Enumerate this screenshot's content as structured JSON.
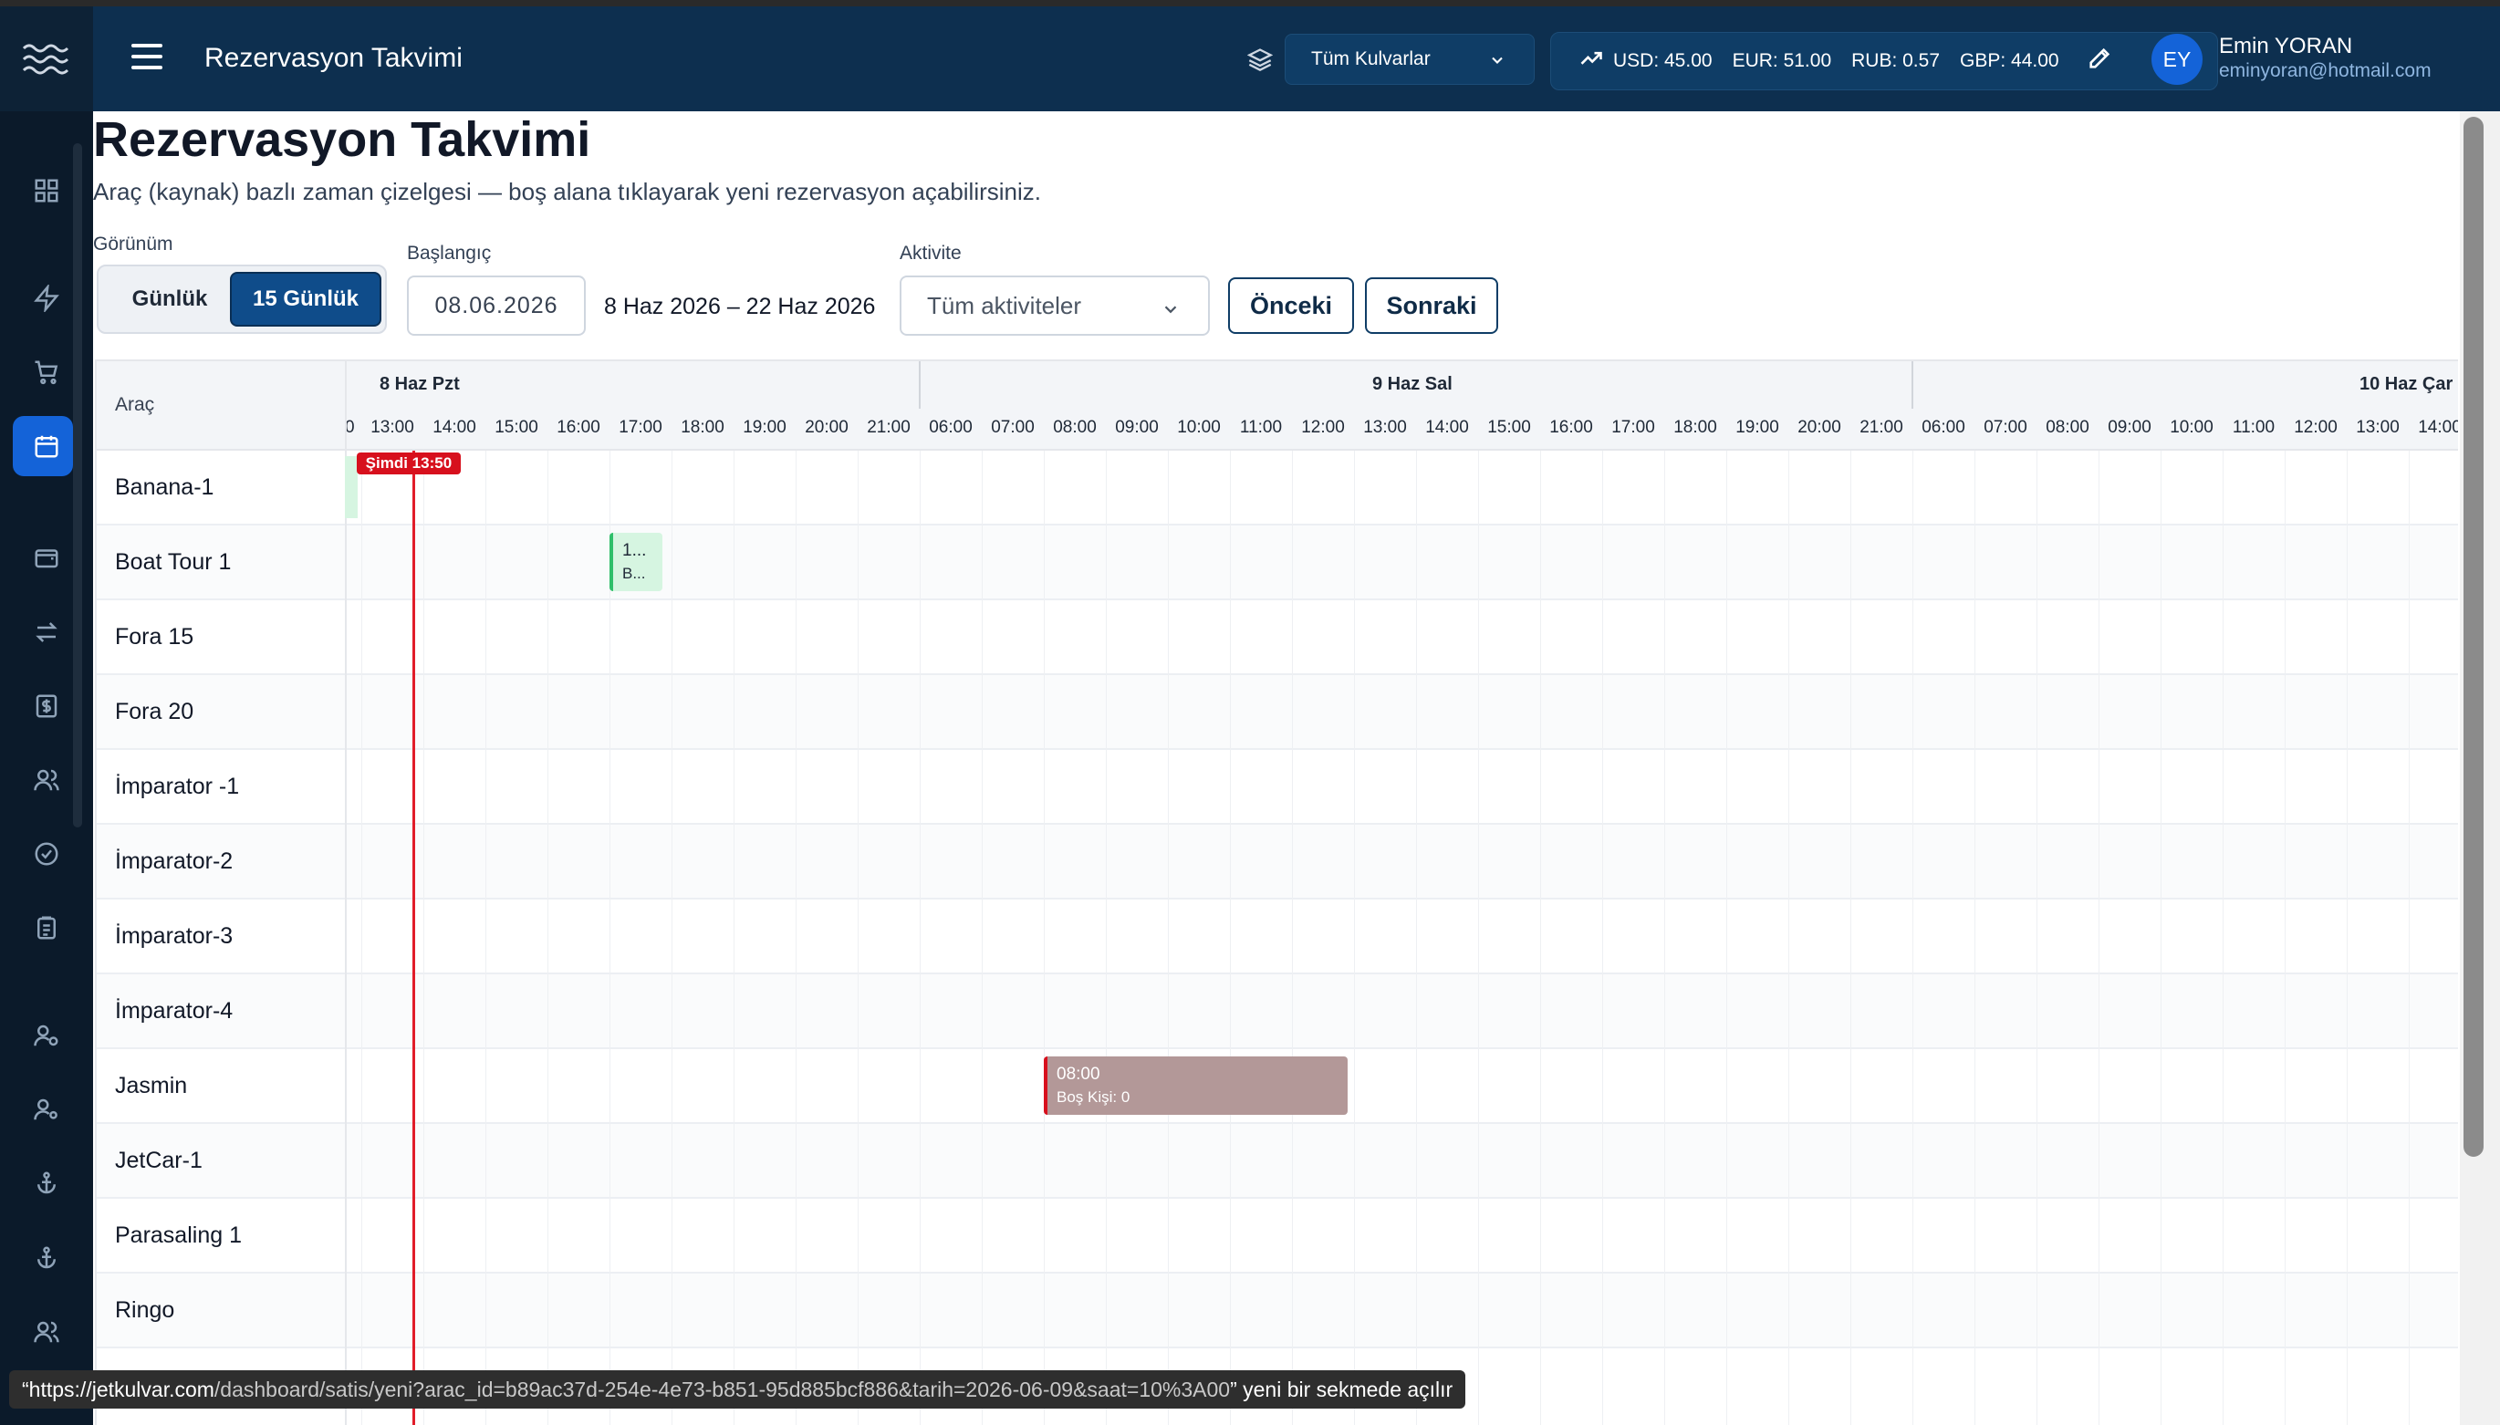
{
  "header": {
    "title": "Rezervasyon Takvimi",
    "route_select": "Tüm Kulvarlar",
    "rates": [
      "USD: 45.00",
      "EUR: 51.00",
      "RUB: 0.57",
      "GBP: 44.00"
    ],
    "user": {
      "initials": "EY",
      "name": "Emin YORAN",
      "email": "eminyoran@hotmail.com"
    }
  },
  "page": {
    "title": "Rezervasyon Takvimi",
    "subtitle": "Araç (kaynak) bazlı zaman çizelgesi — boş alana tıklayarak yeni rezervasyon açabilirsiniz."
  },
  "controls": {
    "view_label": "Görünüm",
    "view_daily": "Günlük",
    "view_15": "15 Günlük",
    "start_label": "Başlangıç",
    "start_value": "08.06.2026",
    "range": "8 Haz 2026 – 22 Haz 2026",
    "activity_label": "Aktivite",
    "activity_value": "Tüm aktiviteler",
    "prev": "Önceki",
    "next": "Sonraki"
  },
  "timeline": {
    "resource_header": "Araç",
    "days": [
      {
        "label": "8 Haz Pzt",
        "hours": [
          "13:00",
          "14:00",
          "15:00",
          "16:00",
          "17:00",
          "18:00",
          "19:00",
          "20:00",
          "21:00"
        ]
      },
      {
        "label": "9 Haz Sal",
        "hours": [
          "06:00",
          "07:00",
          "08:00",
          "09:00",
          "10:00",
          "11:00",
          "12:00",
          "13:00",
          "14:00",
          "15:00",
          "16:00",
          "17:00",
          "18:00",
          "19:00",
          "20:00",
          "21:00"
        ]
      },
      {
        "label": "10 Haz Çar",
        "hours": [
          "06:00",
          "07:00",
          "08:00",
          "09:00",
          "10:00",
          "11:00",
          "12:00",
          "13:00",
          "14:00"
        ]
      }
    ],
    "first_partial_hour": "0",
    "now_label": "Şimdi 13:50",
    "resources": [
      "Banana-1",
      "Boat Tour 1",
      "Fora 15",
      "Fora 20",
      "İmparator -1",
      "İmparator-2",
      "İmparator-3",
      "İmparator-4",
      "Jasmin",
      "JetCar-1",
      "Parasaling 1",
      "Ringo"
    ],
    "bookings": [
      {
        "resource": "Boat Tour 1",
        "line1": "1...",
        "line2": "B...",
        "color": "#2fbf6a"
      },
      {
        "resource": "Jasmin",
        "line1": "08:00",
        "line2": "Boş Kişi: 0",
        "color": "#d7101d"
      }
    ]
  },
  "statusbar": {
    "quote_open": "“",
    "host": "https://jetkulvar.com",
    "path": "/dashboard/satis/yeni?arac_id=b89ac37d-254e-4e73-b851-95d885bcf886&tarih=2026-06-09&saat=10%3A00",
    "suffix": "” yeni bir sekmede açılır"
  },
  "colors": {
    "accent": "#1463d8",
    "header_bg": "#0d2f4f",
    "sidebar_bg": "#0b1a2a",
    "now": "#e11d2a"
  }
}
